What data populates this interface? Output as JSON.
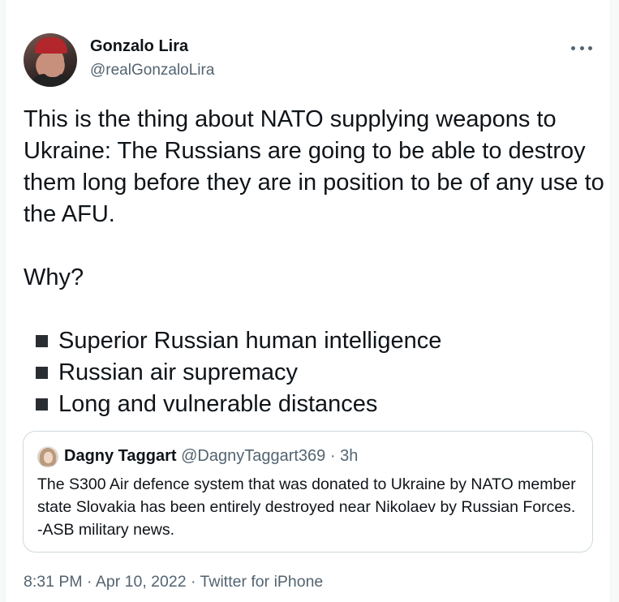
{
  "author": {
    "name": "Gonzalo Lira",
    "handle": "@realGonzaloLira"
  },
  "tweet": {
    "paragraph1": "This is the thing about NATO supplying weapons to Ukraine: The Russians are going to be able to destroy them long before they are in position to be of any use to the AFU.",
    "paragraph2": "Why?",
    "bullets": [
      "Superior Russian human intelligence",
      "Russian air supremacy",
      "Long and vulnerable distances"
    ]
  },
  "quoted": {
    "name": "Dagny Taggart",
    "handle": "@DagnyTaggart369",
    "separator": " · ",
    "time": "3h",
    "text": "The S300 Air defence system that was donated to Ukraine by NATO member state Slovakia has been entirely destroyed near Nikolaev by Russian Forces. -ASB military news."
  },
  "footer": {
    "time": "8:31 PM",
    "date": "Apr 10, 2022",
    "source": "Twitter for iPhone",
    "separator": " · "
  },
  "icons": {
    "more": "more-horizontal-icon"
  }
}
